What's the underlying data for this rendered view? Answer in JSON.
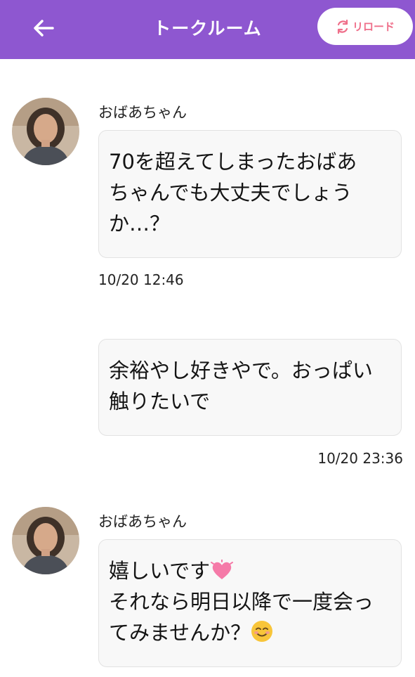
{
  "header": {
    "title": "トークルーム",
    "reload_label": "リロード"
  },
  "messages": [
    {
      "sender": "おばあちゃん",
      "text": "70を超えてしまったおばあ\nちゃんでも大丈夫でしょう\nか…？",
      "time": "10/20 12:46",
      "direction": "incoming"
    },
    {
      "text": "余裕やし好きやで。おっぱい\n触りたいで",
      "time": "10/20 23:36",
      "direction": "outgoing"
    },
    {
      "sender": "おばあちゃん",
      "line1": "嬉しいです",
      "line2": "それなら明日以降で一度会っ",
      "line3": "てみませんか？",
      "direction": "incoming",
      "emojis": [
        "heart-emoji",
        "smile-emoji"
      ]
    }
  ],
  "colors": {
    "header": "#8e57d0",
    "accent_pink": "#ef6f8a",
    "bubble_bg": "#f8f8f8"
  }
}
